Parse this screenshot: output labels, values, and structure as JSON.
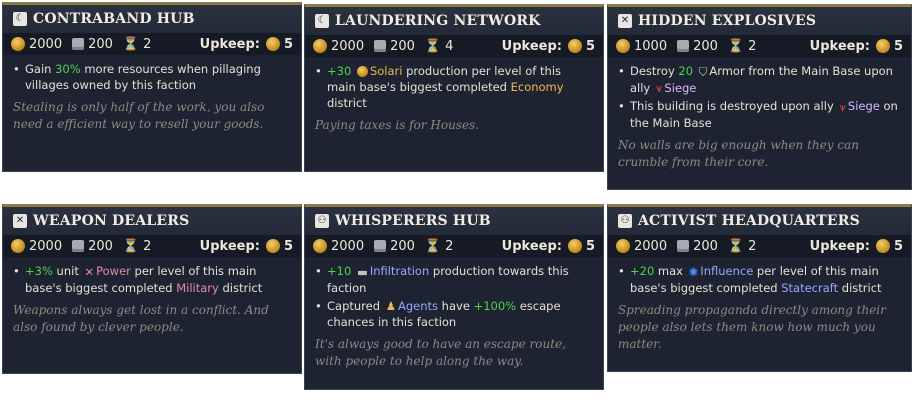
{
  "cards": [
    {
      "title": "CONTRABAND HUB",
      "icon": "mask-icon",
      "gold": "2000",
      "stone": "200",
      "time": "2",
      "upkeep_label": "Upkeep:",
      "upkeep": "5",
      "b1": {
        "a": "Gain ",
        "b": "30%",
        "c": " more resources when pillaging villages owned by this faction"
      },
      "flavor": "Stealing is only half of the work, you also need a efficient way to resell your goods."
    },
    {
      "title": "LAUNDERING NETWORK",
      "icon": "mask-icon",
      "gold": "2000",
      "stone": "200",
      "time": "4",
      "upkeep_label": "Upkeep:",
      "upkeep": "5",
      "b1": {
        "a": "+30",
        "b": "Solari",
        "c": " production per level of this main base's biggest completed ",
        "d": "Economy",
        "e": " district"
      },
      "flavor": "Paying taxes is for Houses."
    },
    {
      "title": "HIDDEN EXPLOSIVES",
      "icon": "swords-icon",
      "gold": "1000",
      "stone": "200",
      "time": "2",
      "upkeep_label": "Upkeep:",
      "upkeep": "5",
      "b1": {
        "a": "Destroy ",
        "b": "20",
        "c": "Armor",
        "d": " from the Main Base upon ally ",
        "e": "Siege"
      },
      "b2": {
        "a": "This building is destroyed upon ally ",
        "b": "Siege",
        "c": " on the Main Base"
      },
      "flavor": "No walls are big enough when they can crumble from their core."
    },
    {
      "title": "WEAPON DEALERS",
      "icon": "swords-icon",
      "gold": "2000",
      "stone": "200",
      "time": "2",
      "upkeep_label": "Upkeep:",
      "upkeep": "5",
      "b1": {
        "a": "+3%",
        "b": " unit ",
        "c": "Power",
        "d": " per level of this main base's biggest completed ",
        "e": "Military",
        "f": " district"
      },
      "flavor": "Weapons always get lost in a conflict. And also found by clever people."
    },
    {
      "title": "WHISPERERS HUB",
      "icon": "agents-icon",
      "gold": "2000",
      "stone": "200",
      "time": "2",
      "upkeep_label": "Upkeep:",
      "upkeep": "5",
      "b1": {
        "a": "+10",
        "b": "Infiltration",
        "c": " production towards this faction"
      },
      "b2": {
        "a": "Captured ",
        "b": "Agents",
        "c": " have ",
        "d": "+100%",
        "e": " escape chances in this faction"
      },
      "flavor": "It's always good to have an escape route, with people to help along the way."
    },
    {
      "title": "ACTIVIST HEADQUARTERS",
      "icon": "agents-icon",
      "gold": "2000",
      "stone": "200",
      "time": "2",
      "upkeep_label": "Upkeep:",
      "upkeep": "5",
      "b1": {
        "a": "+20",
        "b": " max ",
        "c": "Influence",
        "d": " per level of this main base's biggest completed ",
        "e": "Statecraft",
        "f": " district"
      },
      "flavor": "Spreading propaganda directly among their people also lets them know how much you matter."
    }
  ]
}
